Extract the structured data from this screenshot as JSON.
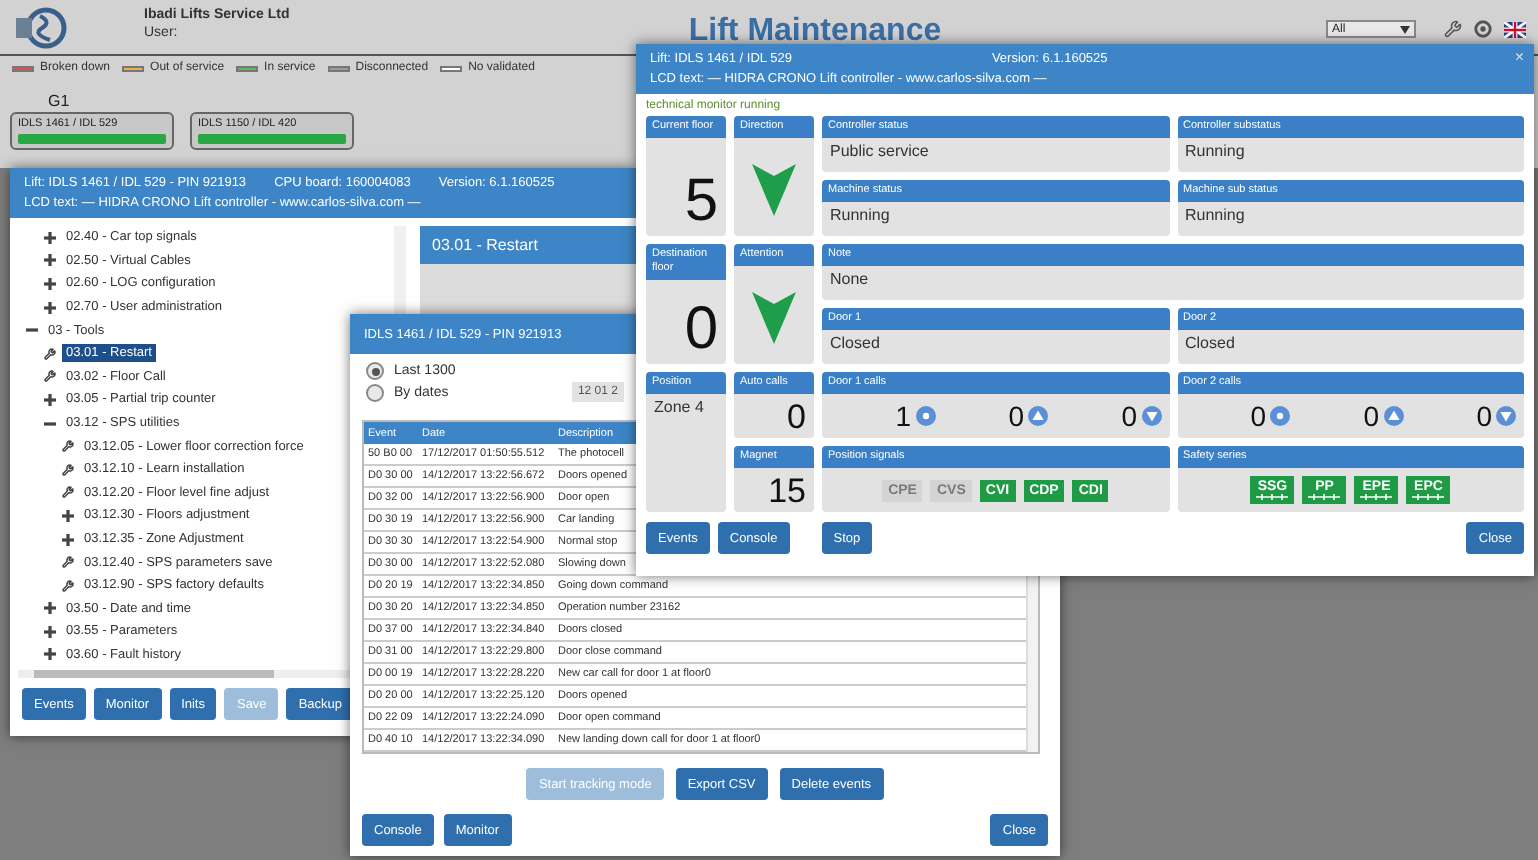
{
  "header": {
    "company": "Ibadi Lifts Service Ltd",
    "user_label": "User:",
    "title": "Lift Maintenance",
    "filter": "All"
  },
  "legend": [
    {
      "label": "Broken down",
      "color": "#d9534f"
    },
    {
      "label": "Out of service",
      "color": "#f0ad4e"
    },
    {
      "label": "In service",
      "color": "#5cb85c"
    },
    {
      "label": "Disconnected",
      "color": "#9a9a9a"
    },
    {
      "label": "No validated",
      "color": "#ffffff"
    }
  ],
  "group": {
    "name": "G1",
    "lifts": [
      {
        "label": "IDLS 1461 / IDL 529",
        "color": "#28a745"
      },
      {
        "label": "IDLS 1150 / IDL 420",
        "color": "#28a745"
      }
    ]
  },
  "config_window": {
    "lift": "Lift: IDLS 1461 / IDL 529 - PIN 921913",
    "cpu": "CPU board: 160004083",
    "version": "Version: 6.1.160525",
    "lcd": "LCD text: — HIDRA CRONO Lift controller - www.carlos-silva.com —",
    "tree": [
      {
        "kind": "continued",
        "children": [
          {
            "kind": "folder",
            "label": "02.40 - Car top signals",
            "expanded": false,
            "selected": false
          },
          {
            "kind": "folder",
            "label": "02.50 - Virtual Cables",
            "expanded": false,
            "selected": false
          },
          {
            "kind": "folder",
            "label": "02.60 - LOG configuration",
            "expanded": false,
            "selected": false
          },
          {
            "kind": "folder",
            "label": "02.70 - User administration",
            "expanded": false,
            "selected": false
          }
        ]
      },
      {
        "kind": "folder",
        "label": "03 - Tools",
        "expanded": true,
        "selected": false,
        "children": [
          {
            "kind": "action",
            "label": "03.01 - Restart",
            "selected": true
          },
          {
            "kind": "action",
            "label": "03.02 - Floor Call",
            "selected": false
          },
          {
            "kind": "folder",
            "label": "03.05 - Partial trip counter",
            "expanded": false,
            "selected": false
          },
          {
            "kind": "folder",
            "label": "03.12 - SPS utilities",
            "expanded": true,
            "selected": false,
            "children": [
              {
                "kind": "action",
                "label": "03.12.05 - Lower floor correction force",
                "selected": false
              },
              {
                "kind": "action",
                "label": "03.12.10 - Learn installation",
                "selected": false
              },
              {
                "kind": "action",
                "label": "03.12.20 - Floor level fine adjust",
                "selected": false
              },
              {
                "kind": "folder",
                "label": "03.12.30 - Floors adjustment",
                "expanded": false,
                "selected": false
              },
              {
                "kind": "folder",
                "label": "03.12.35 - Zone Adjustment",
                "expanded": false,
                "selected": false
              },
              {
                "kind": "action",
                "label": "03.12.40 - SPS parameters save",
                "selected": false
              },
              {
                "kind": "action",
                "label": "03.12.90 - SPS factory defaults",
                "selected": false
              }
            ]
          },
          {
            "kind": "folder",
            "label": "03.50 - Date and time",
            "expanded": false,
            "selected": false
          },
          {
            "kind": "folder",
            "label": "03.55 - Parameters",
            "expanded": false,
            "selected": false
          },
          {
            "kind": "folder",
            "label": "03.60 - Fault history",
            "expanded": false,
            "selected": false
          }
        ]
      }
    ],
    "panel_title": "03.01 - Restart",
    "buttons": [
      {
        "label": "Events",
        "disabled": false
      },
      {
        "label": "Monitor",
        "disabled": false
      },
      {
        "label": "Inits",
        "disabled": false
      },
      {
        "label": "Save",
        "disabled": true
      },
      {
        "label": "Backup",
        "disabled": false
      }
    ]
  },
  "events_window": {
    "title": "IDLS 1461 / IDL 529 - PIN 921913",
    "range_options": [
      {
        "label": "Last 1300",
        "selected": true
      },
      {
        "label": "By dates",
        "selected": false
      }
    ],
    "date_from": "12 01 2",
    "columns": [
      "Event",
      "Date",
      "Description"
    ],
    "rows": [
      {
        "event": "50 B0 00",
        "date": "17/12/2017 01:50:55.512",
        "description": "The photocell"
      },
      {
        "event": "D0 30 00",
        "date": "14/12/2017 13:22:56.672",
        "description": "Doors opened"
      },
      {
        "event": "D0 32 00",
        "date": "14/12/2017 13:22:56.900",
        "description": "Door open"
      },
      {
        "event": "D0 30 19",
        "date": "14/12/2017 13:22:56.900",
        "description": "Car landing"
      },
      {
        "event": "D0 30 30",
        "date": "14/12/2017 13:22:54.900",
        "description": "Normal stop"
      },
      {
        "event": "D0 30 00",
        "date": "14/12/2017 13:22:52.080",
        "description": "Slowing down"
      },
      {
        "event": "D0 20 19",
        "date": "14/12/2017 13:22:34.850",
        "description": "Going down command"
      },
      {
        "event": "D0 30 20",
        "date": "14/12/2017 13:22:34.850",
        "description": "Operation number 23162"
      },
      {
        "event": "D0 37 00",
        "date": "14/12/2017 13:22:34.840",
        "description": "Doors closed"
      },
      {
        "event": "D0 31 00",
        "date": "14/12/2017 13:22:29.800",
        "description": "Door close command"
      },
      {
        "event": "D0 00 19",
        "date": "14/12/2017 13:22:28.220",
        "description": "New car call for door 1 at floor0"
      },
      {
        "event": "D0 20 00",
        "date": "14/12/2017 13:22:25.120",
        "description": "Doors opened"
      },
      {
        "event": "D0 22 09",
        "date": "14/12/2017 13:22:24.090",
        "description": "Door open command"
      },
      {
        "event": "D0 40 10",
        "date": "14/12/2017 13:22:34.090",
        "description": "New landing down call for door 1 at floor0"
      }
    ],
    "action_buttons": [
      {
        "label": "Start tracking mode",
        "disabled": true
      },
      {
        "label": "Export CSV",
        "disabled": false
      },
      {
        "label": "Delete events",
        "disabled": false
      }
    ],
    "footer_buttons": [
      "Console",
      "Monitor"
    ],
    "close_button": "Close"
  },
  "monitor_window": {
    "lift": "Lift: IDLS 1461 / IDL 529",
    "version": "Version: 6.1.160525",
    "lcd": "LCD text: — HIDRA CRONO Lift controller - www.carlos-silva.com —",
    "close": "×",
    "status_note": "technical monitor running",
    "current_floor": {
      "label": "Current floor",
      "value": "5"
    },
    "direction": {
      "label": "Direction",
      "down": true
    },
    "controller_status": {
      "label": "Controller status",
      "value": "Public service"
    },
    "controller_substatus": {
      "label": "Controller substatus",
      "value": "Running"
    },
    "machine_status": {
      "label": "Machine status",
      "value": "Running"
    },
    "machine_sub_status": {
      "label": "Machine sub status",
      "value": "Running"
    },
    "destination_floor": {
      "label": "Destination floor",
      "value": "0"
    },
    "attention": {
      "label": "Attention",
      "down": true
    },
    "note": {
      "label": "Note",
      "value": "None"
    },
    "door_1": {
      "label": "Door 1",
      "value": "Closed"
    },
    "door_2": {
      "label": "Door 2",
      "value": "Closed"
    },
    "position": {
      "label": "Position",
      "value": "Zone 4"
    },
    "auto_calls": {
      "label": "Auto calls",
      "value": "0"
    },
    "magnet": {
      "label": "Magnet",
      "value": "15"
    },
    "door_1_calls": {
      "label": "Door 1 calls",
      "calls": [
        {
          "count": "1",
          "kind": "cabin"
        },
        {
          "count": "0",
          "kind": "up"
        },
        {
          "count": "0",
          "kind": "down"
        }
      ]
    },
    "door_2_calls": {
      "label": "Door 2 calls",
      "calls": [
        {
          "count": "0",
          "kind": "cabin"
        },
        {
          "count": "0",
          "kind": "up"
        },
        {
          "count": "0",
          "kind": "down"
        }
      ]
    },
    "position_signals": {
      "label": "Position signals",
      "signals": [
        {
          "label": "CPE",
          "on": false
        },
        {
          "label": "CVS",
          "on": false
        },
        {
          "label": "CVI",
          "on": true
        },
        {
          "label": "CDP",
          "on": true
        },
        {
          "label": "CDI",
          "on": true
        }
      ]
    },
    "safety_series": {
      "label": "Safety series",
      "signals": [
        {
          "label": "SSG",
          "on": true
        },
        {
          "label": "PP",
          "on": true
        },
        {
          "label": "EPE",
          "on": true
        },
        {
          "label": "EPC",
          "on": true
        }
      ]
    },
    "left_buttons": [
      "Events",
      "Console"
    ],
    "stop_button": "Stop",
    "close_button": "Close"
  }
}
